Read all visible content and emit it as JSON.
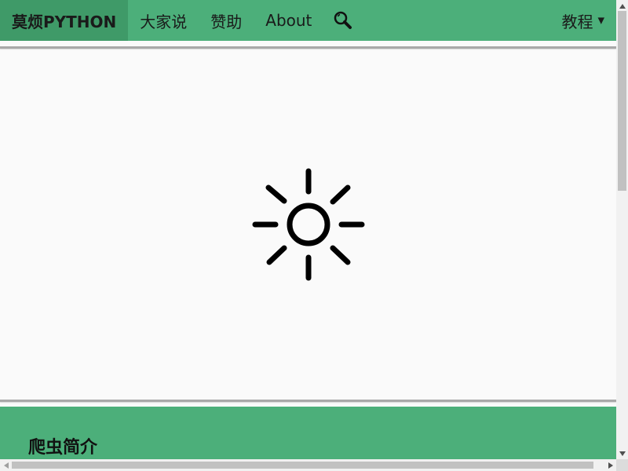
{
  "navbar": {
    "brand": "莫烦PYTHON",
    "items": [
      "大家说",
      "赞助",
      "About"
    ],
    "search_icon": "search-icon",
    "right_menu": {
      "label": "教程",
      "caret": "▾"
    }
  },
  "hero": {
    "icon": "sun-icon"
  },
  "section": {
    "title": "爬虫简介"
  },
  "colors": {
    "nav_bg": "#4caf7a",
    "brand_bg": "#3f9a68",
    "page_bg": "#fafafa"
  }
}
